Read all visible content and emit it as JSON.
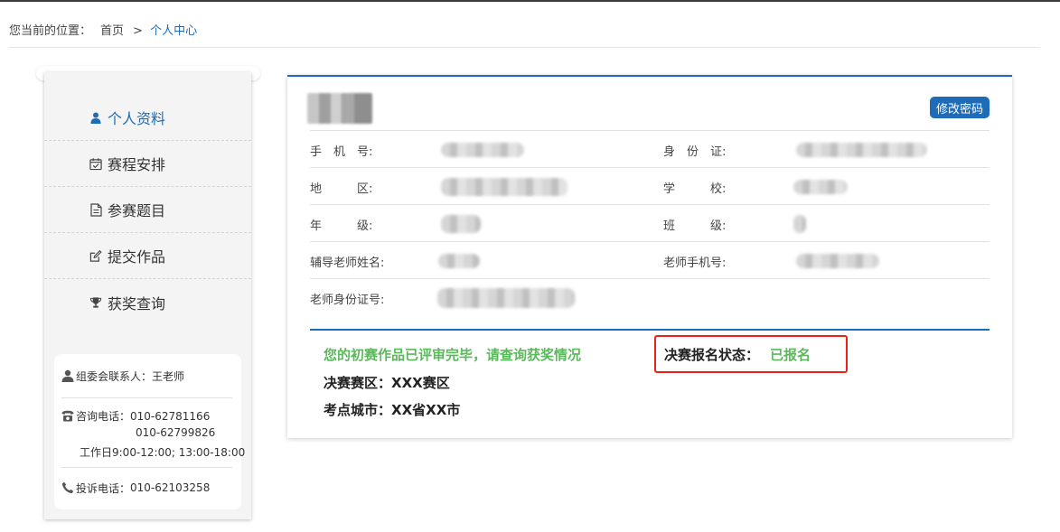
{
  "breadcrumb": {
    "prefix": "您当前的位置：",
    "home": "首页",
    "separator": ">",
    "current": "个人中心"
  },
  "sidebar": {
    "items": [
      {
        "label": "个人资料",
        "icon": "user-icon",
        "active": true
      },
      {
        "label": "赛程安排",
        "icon": "calendar-check-icon",
        "active": false
      },
      {
        "label": "参赛题目",
        "icon": "document-icon",
        "active": false
      },
      {
        "label": "提交作品",
        "icon": "edit-icon",
        "active": false
      },
      {
        "label": "获奖查询",
        "icon": "trophy-icon",
        "active": false
      }
    ],
    "contact": {
      "organizer_label": "组委会联系人：",
      "organizer_name": "王老师",
      "phone_label": "咨询电话：",
      "phone1": "010-62781166",
      "phone2": "010-62799826",
      "hours": "工作日9:00-12:00; 13:00-18:00",
      "complaint_label": "投诉电话：",
      "complaint_phone": "010-62103258"
    }
  },
  "profile": {
    "change_password_label": "修改密码",
    "fields": {
      "mobile_label": "手　机　号:",
      "id_label": "身　份　证:",
      "region_label": "地　　　区:",
      "school_label": "学　　　校:",
      "grade_label": "年　　　级:",
      "class_label": "班　　　级:",
      "tutor_name_label": "辅导老师姓名:",
      "tutor_phone_label": "老师手机号:",
      "tutor_id_label": "老师身份证号:"
    },
    "status_message": "您的初赛作品已评审完毕，请查询获奖情况",
    "final_area_label": "决赛赛区：",
    "final_area_value": "XXX赛区",
    "exam_city_label": "考点城市：",
    "exam_city_value": "XX省XX市",
    "registration_status_label": "决赛报名状态：",
    "registration_status_value": "已报名"
  },
  "colors": {
    "accent": "#1e6bb8",
    "success": "#5cb85c",
    "highlight_border": "#e8211a"
  }
}
